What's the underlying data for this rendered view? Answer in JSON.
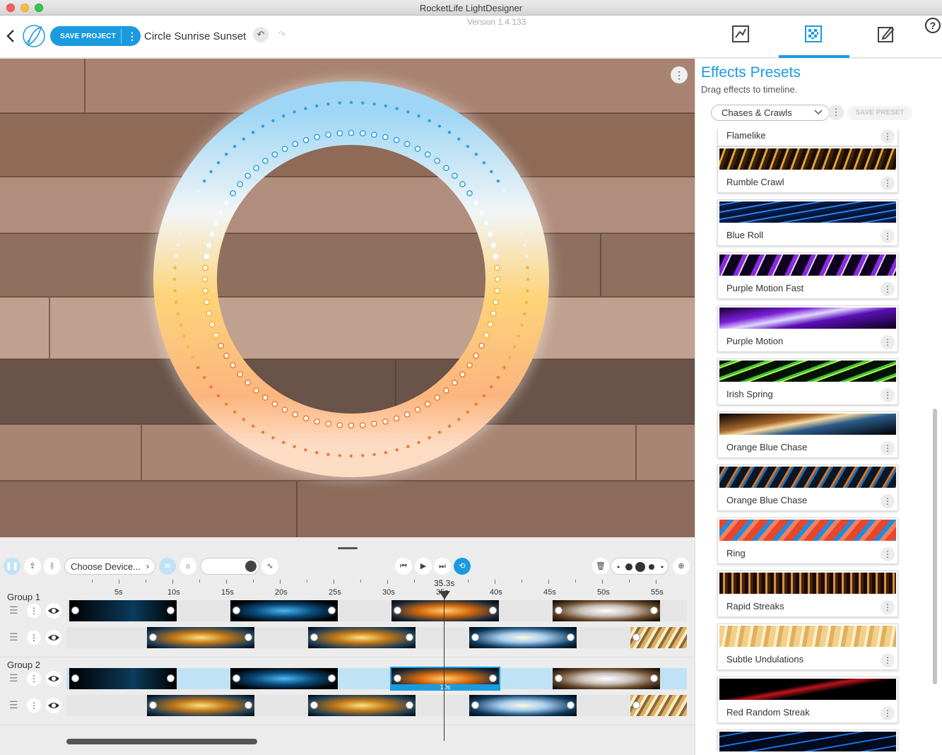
{
  "window": {
    "title": "RocketLife LightDesigner",
    "version": "Version 1.4 133"
  },
  "topbar": {
    "save_label": "SAVE PROJECT",
    "project_name": "Circle Sunrise Sunset",
    "tabs": [
      {
        "name": "edit-effects-tab",
        "icon": "graph-edit-icon",
        "active": false
      },
      {
        "name": "effects-presets-tab",
        "icon": "checker-grid-icon",
        "active": true
      },
      {
        "name": "notes-tab",
        "icon": "pencil-edit-icon",
        "active": false
      }
    ]
  },
  "sidebar": {
    "title": "Effects Presets",
    "subtitle": "Drag effects to timeline.",
    "category": "Chases & Crawls",
    "save_preset_label": "SAVE PRESET",
    "presets": [
      {
        "name": "Flamelike"
      },
      {
        "name": "Rumble Crawl"
      },
      {
        "name": "Blue Roll"
      },
      {
        "name": "Purple Motion Fast"
      },
      {
        "name": "Purple Motion"
      },
      {
        "name": "Irish Spring"
      },
      {
        "name": "Orange Blue Chase"
      },
      {
        "name": "Orange Blue Chase"
      },
      {
        "name": "Ring"
      },
      {
        "name": "Rapid Streaks"
      },
      {
        "name": "Subtle Undulations"
      },
      {
        "name": "Red Random Streak"
      },
      {
        "name": ""
      }
    ]
  },
  "toolbar": {
    "device_placeholder": "Choose Device..."
  },
  "timeline": {
    "playhead": "35.3s",
    "selected_duration": "10s",
    "ruler_labels": [
      "5s",
      "10s",
      "15s",
      "20s",
      "25s",
      "30s",
      "35s",
      "40s",
      "45s",
      "50s",
      "55s"
    ],
    "groups": [
      {
        "label": "Group 1"
      },
      {
        "label": "Group 2"
      }
    ]
  },
  "colors": {
    "accent": "#1a9be0",
    "track_selected": "#bfe3f5"
  }
}
